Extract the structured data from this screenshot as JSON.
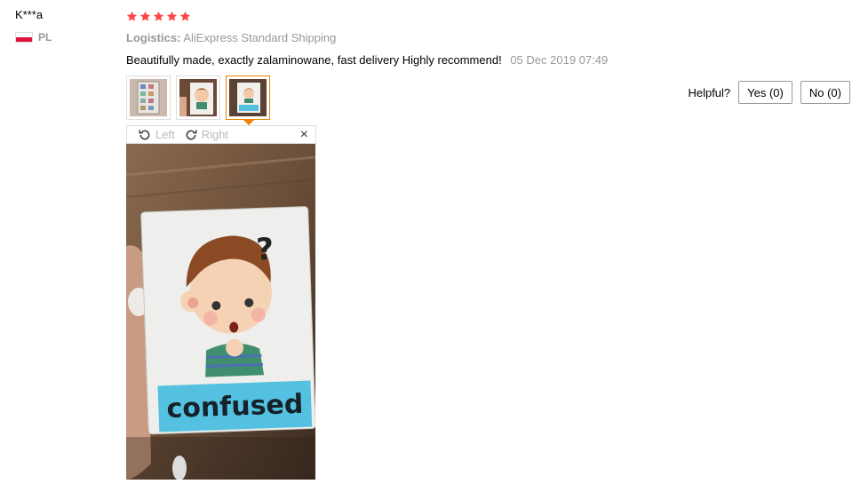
{
  "review": {
    "user_name": "K***a",
    "country_code": "PL",
    "rating": 5,
    "logistics_label": "Logistics:",
    "logistics_value": "AliExpress Standard Shipping",
    "comment": "Beautifully made, exactly zalaminowane, fast delivery Highly recommend!",
    "date": "05 Dec 2019 07:49",
    "helpful_label": "Helpful?",
    "yes_label": "Yes (0)",
    "no_label": "No (0)",
    "photo_count": 3,
    "active_photo": 3
  },
  "viewer": {
    "rotate_left_label": "Left",
    "rotate_right_label": "Right",
    "close_label": "×",
    "card_text": "confused",
    "card_mark": "?"
  },
  "colors": {
    "star": "#f44",
    "accent": "#f08200",
    "card_banner": "#55c1e0"
  },
  "icons": [
    "star-icon",
    "flag-pl-icon",
    "rotate-left-icon",
    "rotate-right-icon",
    "close-icon"
  ]
}
